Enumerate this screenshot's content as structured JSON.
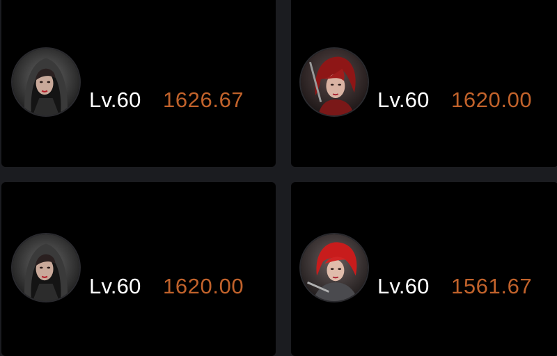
{
  "cards": [
    {
      "level": "Lv.60",
      "score": "1626.67",
      "avatar": "hooded-assassin-avatar"
    },
    {
      "level": "Lv.60",
      "score": "1620.00",
      "avatar": "red-haired-warrior-avatar"
    },
    {
      "level": "Lv.60",
      "score": "1620.00",
      "avatar": "hooded-assassin-avatar"
    },
    {
      "level": "Lv.60",
      "score": "1561.67",
      "avatar": "red-haired-swordswoman-avatar"
    }
  ],
  "colors": {
    "background": "#1b1c20",
    "card": "#000000",
    "level_text": "#ffffff",
    "score_text": "#c1622b"
  }
}
